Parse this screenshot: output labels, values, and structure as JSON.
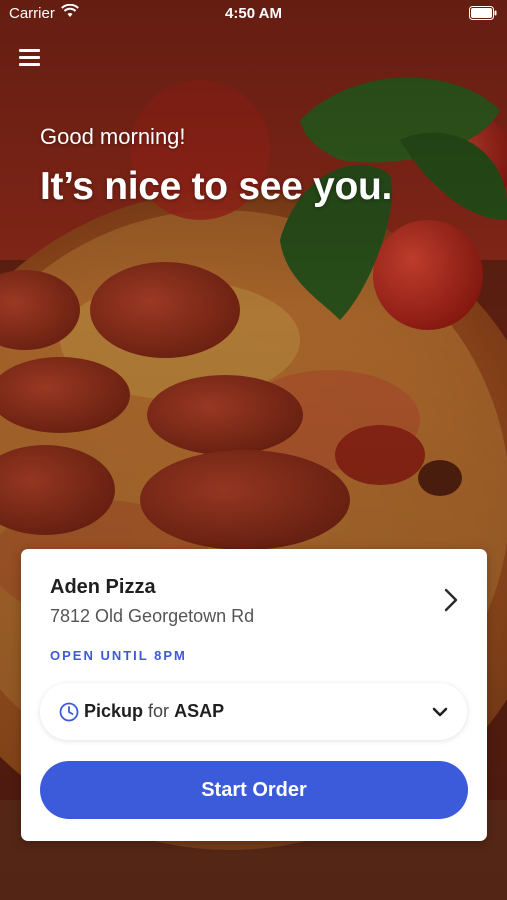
{
  "status_bar": {
    "carrier": "Carrier",
    "time": "4:50 AM",
    "wifi_icon": "wifi-icon",
    "battery_icon": "battery-icon"
  },
  "header": {
    "menu_icon": "hamburger-menu-icon",
    "greeting": "Good morning!",
    "headline": "It’s nice to see you."
  },
  "store": {
    "name": "Aden Pizza",
    "address": "7812 Old Georgetown Rd",
    "hours": "OPEN UNTIL 8PM",
    "chevron_icon": "chevron-right-icon"
  },
  "order_type": {
    "icon": "clock-icon",
    "mode": "Pickup",
    "connector": "for",
    "time": "ASAP",
    "dropdown_icon": "chevron-down-icon"
  },
  "actions": {
    "start_order": "Start Order"
  },
  "colors": {
    "accent": "#3b5bdb",
    "card_background": "#ffffff",
    "text_primary": "#1f1f1f"
  }
}
